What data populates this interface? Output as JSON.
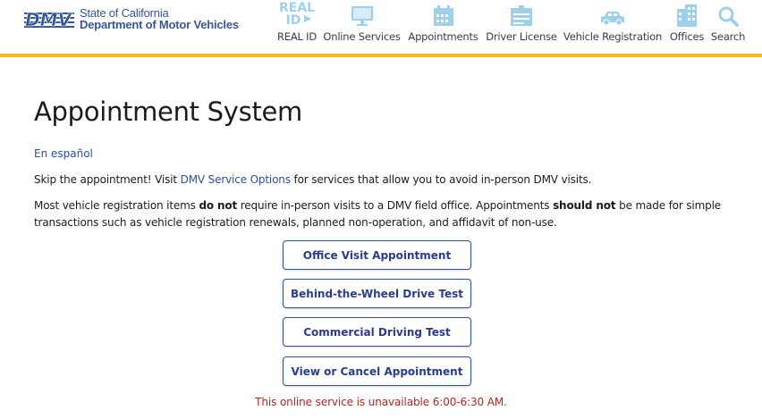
{
  "header": {
    "logo_mark": "DMV",
    "logo_state": "State of California",
    "logo_dept": "Department of Motor Vehicles",
    "nav": [
      {
        "label": "REAL ID",
        "icon": "real-id-icon"
      },
      {
        "label": "Online Services",
        "icon": "monitor-icon"
      },
      {
        "label": "Appointments",
        "icon": "calendar-icon"
      },
      {
        "label": "Driver License",
        "icon": "id-card-icon"
      },
      {
        "label": "Vehicle Registration",
        "icon": "car-icon"
      },
      {
        "label": "Offices",
        "icon": "building-icon"
      },
      {
        "label": "Search",
        "icon": "search-icon"
      }
    ],
    "accent_color": "#fdb81e",
    "brand_color": "#34579a"
  },
  "main": {
    "title": "Appointment System",
    "language_link": "En español",
    "skip_text_1": "Skip the appointment! Visit ",
    "skip_link": "DMV Service Options",
    "skip_text_2": " for services that allow you to avoid in-person DMV visits.",
    "reg_text_1": "Most vehicle registration items ",
    "reg_bold_1": "do not",
    "reg_text_2": " require in-person visits to a DMV field office. Appointments ",
    "reg_bold_2": "should not",
    "reg_text_3": " be made for simple transactions such as vehicle registration renewals, planned non-operation, and affidavit of non-use.",
    "buttons": {
      "office_visit": "Office Visit Appointment",
      "behind_wheel": "Behind-the-Wheel Drive Test",
      "commercial": "Commercial Driving Test",
      "view_cancel": "View or Cancel Appointment"
    },
    "notice": "This online service is unavailable 6:00-6:30 AM.",
    "link_color": "#2a4fa1",
    "notice_color": "#b3261e"
  }
}
